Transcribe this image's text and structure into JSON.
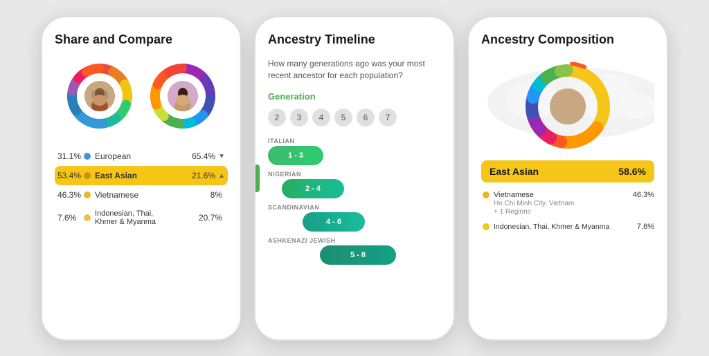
{
  "phone1": {
    "title": "Share and Compare",
    "stats": [
      {
        "pct_left": "31.1%",
        "dot_color": "#4a90d9",
        "label": "European",
        "pct_right": "65.4%",
        "highlighted": false,
        "chevron": "▼"
      },
      {
        "pct_left": "53.4%",
        "dot_color": "#f5c518",
        "label": "East Asian",
        "pct_right": "21.6%",
        "highlighted": true,
        "chevron": "▲"
      },
      {
        "pct_left": "46.3%",
        "dot_color": "#f0b429",
        "label": "Vietnamese",
        "pct_right": "8%",
        "highlighted": false,
        "chevron": ""
      },
      {
        "pct_left": "7.6%",
        "dot_color": "#f0c040",
        "label": "Indonesian, Thai,\nKhmer & Myanma",
        "pct_right": "20.7%",
        "highlighted": false,
        "chevron": ""
      }
    ],
    "donut1_segments": [
      {
        "color": "#e74c3c",
        "pct": 8
      },
      {
        "color": "#e67e22",
        "pct": 10
      },
      {
        "color": "#f1c40f",
        "pct": 12
      },
      {
        "color": "#2ecc71",
        "pct": 10
      },
      {
        "color": "#1abc9c",
        "pct": 8
      },
      {
        "color": "#3498db",
        "pct": 18
      },
      {
        "color": "#2980b9",
        "pct": 12
      },
      {
        "color": "#9b59b6",
        "pct": 8
      },
      {
        "color": "#e91e63",
        "pct": 6
      },
      {
        "color": "#ff5722",
        "pct": 8
      }
    ],
    "donut2_segments": [
      {
        "color": "#9c27b0",
        "pct": 15
      },
      {
        "color": "#673ab7",
        "pct": 12
      },
      {
        "color": "#3f51b5",
        "pct": 10
      },
      {
        "color": "#2196f3",
        "pct": 8
      },
      {
        "color": "#00bcd4",
        "pct": 7
      },
      {
        "color": "#4caf50",
        "pct": 10
      },
      {
        "color": "#cddc39",
        "pct": 8
      },
      {
        "color": "#ff9800",
        "pct": 12
      },
      {
        "color": "#ff5722",
        "pct": 10
      },
      {
        "color": "#f44336",
        "pct": 8
      }
    ]
  },
  "phone2": {
    "title": "Ancestry Timeline",
    "subtitle": "How many generations ago was your most recent ancestor for each population?",
    "generation_label": "Generation",
    "gen_numbers": [
      "2",
      "3",
      "4",
      "5",
      "6",
      "7"
    ],
    "timeline_items": [
      {
        "pop": "ITALIAN",
        "range": "1 - 3",
        "bar_class": "bar-italian"
      },
      {
        "pop": "NIGERIAN",
        "range": "2 - 4",
        "bar_class": "bar-nigerian"
      },
      {
        "pop": "SCANDINAVIAN",
        "range": "4 - 6",
        "bar_class": "bar-scandinavian"
      },
      {
        "pop": "ASHKENAZI JEWISH",
        "range": "5 - 8",
        "bar_class": "bar-ashkenazi"
      }
    ]
  },
  "phone3": {
    "title": "Ancestry Composition",
    "highlight": {
      "label": "East Asian",
      "pct": "58.6%"
    },
    "sub_items": [
      {
        "dot_color": "#f0b429",
        "label": "Vietnamese",
        "pct": "46.3%",
        "detail1": "Ho Chi Minh City, Vietnam",
        "detail2": "+ 1 Regions"
      },
      {
        "dot_color": "#f5c518",
        "label": "Indonesian, Thai, Khmer &\nMyanma",
        "pct": "7.6%",
        "detail1": "",
        "detail2": ""
      }
    ],
    "donut_segments": [
      {
        "color": "#f5c518",
        "pct": 35
      },
      {
        "color": "#ff9800",
        "pct": 18
      },
      {
        "color": "#ff5722",
        "pct": 5
      },
      {
        "color": "#e91e63",
        "pct": 6
      },
      {
        "color": "#9c27b0",
        "pct": 8
      },
      {
        "color": "#3f51b5",
        "pct": 7
      },
      {
        "color": "#2196f3",
        "pct": 6
      },
      {
        "color": "#00bcd4",
        "pct": 5
      },
      {
        "color": "#4caf50",
        "pct": 7
      },
      {
        "color": "#8bc34a",
        "pct": 3
      }
    ]
  },
  "icons": {
    "chevron_down": "▼",
    "chevron_up": "▲"
  }
}
